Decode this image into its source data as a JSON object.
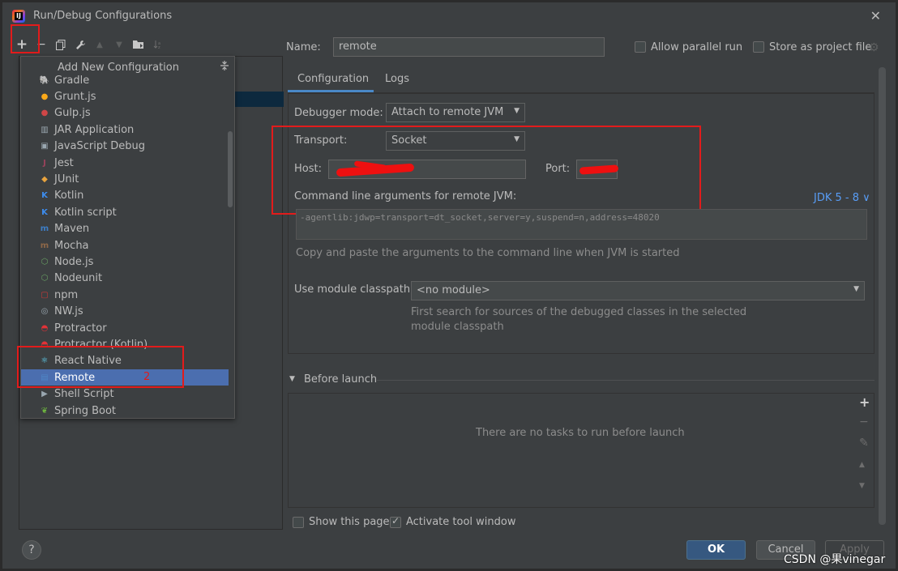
{
  "window": {
    "title": "Run/Debug Configurations"
  },
  "toolbar": {
    "add": "+",
    "remove": "−",
    "copy": "⧉",
    "edit": "🔧",
    "up": "▲",
    "down": "▼",
    "folder": "📁",
    "sort": "↓ª"
  },
  "popup": {
    "title": "Add New Configuration",
    "items": [
      {
        "label": "Gradle",
        "icon": "gradle-icon",
        "color": "#6aa84f",
        "glyph": "🐘"
      },
      {
        "label": "Grunt.js",
        "icon": "grunt-icon",
        "color": "#fba919",
        "glyph": "●"
      },
      {
        "label": "Gulp.js",
        "icon": "gulp-icon",
        "color": "#cf4647",
        "glyph": "●"
      },
      {
        "label": "JAR Application",
        "icon": "jar-icon",
        "color": "#9aa7b0",
        "glyph": "▥"
      },
      {
        "label": "JavaScript Debug",
        "icon": "js-debug-icon",
        "color": "#9aa7b0",
        "glyph": "▣"
      },
      {
        "label": "Jest",
        "icon": "jest-icon",
        "color": "#99425b",
        "glyph": "J"
      },
      {
        "label": "JUnit",
        "icon": "junit-icon",
        "color": "#e8a33e",
        "glyph": "◆"
      },
      {
        "label": "Kotlin",
        "icon": "kotlin-icon",
        "color": "#3d8df0",
        "glyph": "K"
      },
      {
        "label": "Kotlin script",
        "icon": "kotlin-script-icon",
        "color": "#3d8df0",
        "glyph": "K"
      },
      {
        "label": "Maven",
        "icon": "maven-icon",
        "color": "#3d7dc5",
        "glyph": "m"
      },
      {
        "label": "Mocha",
        "icon": "mocha-icon",
        "color": "#8d6748",
        "glyph": "m"
      },
      {
        "label": "Node.js",
        "icon": "nodejs-icon",
        "color": "#68a063",
        "glyph": "⬡"
      },
      {
        "label": "Nodeunit",
        "icon": "nodeunit-icon",
        "color": "#68a063",
        "glyph": "⬡"
      },
      {
        "label": "npm",
        "icon": "npm-icon",
        "color": "#cb3837",
        "glyph": "▢"
      },
      {
        "label": "NW.js",
        "icon": "nwjs-icon",
        "color": "#9aa7b0",
        "glyph": "◎"
      },
      {
        "label": "Protractor",
        "icon": "protractor-icon",
        "color": "#e23237",
        "glyph": "◓"
      },
      {
        "label": "Protractor (Kotlin)",
        "icon": "protractor-kotlin-icon",
        "color": "#e23237",
        "glyph": "◓"
      },
      {
        "label": "React Native",
        "icon": "react-icon",
        "color": "#61dafb",
        "glyph": "⚛"
      },
      {
        "label": "Remote",
        "icon": "remote-icon",
        "color": "#4f86c6",
        "glyph": "▤"
      },
      {
        "label": "Shell Script",
        "icon": "shell-icon",
        "color": "#9aa7b0",
        "glyph": "▶"
      },
      {
        "label": "Spring Boot",
        "icon": "spring-boot-icon",
        "color": "#6db33f",
        "glyph": "❦"
      }
    ],
    "selected_index": 18,
    "annotation": "2"
  },
  "form": {
    "name_label": "Name:",
    "name_value": "remote",
    "allow_parallel_label": "Allow parallel run",
    "store_project_label": "Store as project file",
    "tabs": [
      "Configuration",
      "Logs"
    ],
    "debugger_mode_label": "Debugger mode:",
    "debugger_mode_value": "Attach to remote JVM",
    "transport_label": "Transport:",
    "transport_value": "Socket",
    "host_label": "Host:",
    "port_label": "Port:",
    "cmd_args_label": "Command line arguments for remote JVM:",
    "jdk_link": "JDK 5 - 8 ∨",
    "cmd_args_value": "-agentlib:jdwp=transport=dt_socket,server=y,suspend=n,address=48020",
    "copy_hint": "Copy and paste the arguments to the command line when JVM is started",
    "module_label": "Use module classpath:",
    "module_value": "<no module>",
    "module_hint_1": "First search for sources of the debugged classes in the selected",
    "module_hint_2": "module classpath",
    "before_launch_label": "Before launch",
    "no_tasks": "There are no tasks to run before launch",
    "show_page_label": "Show this page",
    "activate_tool_label": "Activate tool window"
  },
  "buttons": {
    "ok": "OK",
    "cancel": "Cancel",
    "apply": "Apply",
    "help": "?"
  },
  "watermark": "CSDN @果vinegar"
}
